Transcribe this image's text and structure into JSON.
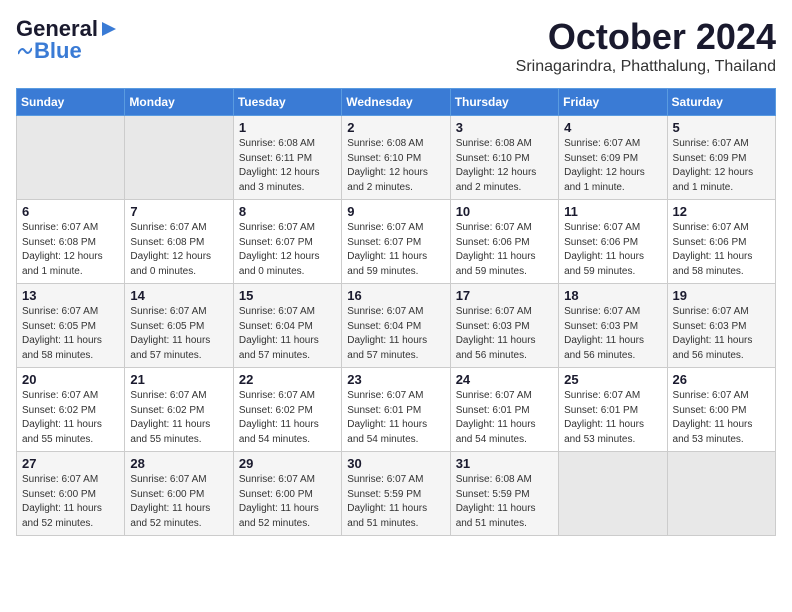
{
  "header": {
    "logo": {
      "general": "General",
      "blue": "Blue"
    },
    "title": "October 2024",
    "subtitle": "Srinagarindra, Phatthalung, Thailand"
  },
  "calendar": {
    "weekdays": [
      "Sunday",
      "Monday",
      "Tuesday",
      "Wednesday",
      "Thursday",
      "Friday",
      "Saturday"
    ],
    "weeks": [
      [
        {
          "day": "",
          "info": ""
        },
        {
          "day": "",
          "info": ""
        },
        {
          "day": "1",
          "info": "Sunrise: 6:08 AM\nSunset: 6:11 PM\nDaylight: 12 hours\nand 3 minutes."
        },
        {
          "day": "2",
          "info": "Sunrise: 6:08 AM\nSunset: 6:10 PM\nDaylight: 12 hours\nand 2 minutes."
        },
        {
          "day": "3",
          "info": "Sunrise: 6:08 AM\nSunset: 6:10 PM\nDaylight: 12 hours\nand 2 minutes."
        },
        {
          "day": "4",
          "info": "Sunrise: 6:07 AM\nSunset: 6:09 PM\nDaylight: 12 hours\nand 1 minute."
        },
        {
          "day": "5",
          "info": "Sunrise: 6:07 AM\nSunset: 6:09 PM\nDaylight: 12 hours\nand 1 minute."
        }
      ],
      [
        {
          "day": "6",
          "info": "Sunrise: 6:07 AM\nSunset: 6:08 PM\nDaylight: 12 hours\nand 1 minute."
        },
        {
          "day": "7",
          "info": "Sunrise: 6:07 AM\nSunset: 6:08 PM\nDaylight: 12 hours\nand 0 minutes."
        },
        {
          "day": "8",
          "info": "Sunrise: 6:07 AM\nSunset: 6:07 PM\nDaylight: 12 hours\nand 0 minutes."
        },
        {
          "day": "9",
          "info": "Sunrise: 6:07 AM\nSunset: 6:07 PM\nDaylight: 11 hours\nand 59 minutes."
        },
        {
          "day": "10",
          "info": "Sunrise: 6:07 AM\nSunset: 6:06 PM\nDaylight: 11 hours\nand 59 minutes."
        },
        {
          "day": "11",
          "info": "Sunrise: 6:07 AM\nSunset: 6:06 PM\nDaylight: 11 hours\nand 59 minutes."
        },
        {
          "day": "12",
          "info": "Sunrise: 6:07 AM\nSunset: 6:06 PM\nDaylight: 11 hours\nand 58 minutes."
        }
      ],
      [
        {
          "day": "13",
          "info": "Sunrise: 6:07 AM\nSunset: 6:05 PM\nDaylight: 11 hours\nand 58 minutes."
        },
        {
          "day": "14",
          "info": "Sunrise: 6:07 AM\nSunset: 6:05 PM\nDaylight: 11 hours\nand 57 minutes."
        },
        {
          "day": "15",
          "info": "Sunrise: 6:07 AM\nSunset: 6:04 PM\nDaylight: 11 hours\nand 57 minutes."
        },
        {
          "day": "16",
          "info": "Sunrise: 6:07 AM\nSunset: 6:04 PM\nDaylight: 11 hours\nand 57 minutes."
        },
        {
          "day": "17",
          "info": "Sunrise: 6:07 AM\nSunset: 6:03 PM\nDaylight: 11 hours\nand 56 minutes."
        },
        {
          "day": "18",
          "info": "Sunrise: 6:07 AM\nSunset: 6:03 PM\nDaylight: 11 hours\nand 56 minutes."
        },
        {
          "day": "19",
          "info": "Sunrise: 6:07 AM\nSunset: 6:03 PM\nDaylight: 11 hours\nand 56 minutes."
        }
      ],
      [
        {
          "day": "20",
          "info": "Sunrise: 6:07 AM\nSunset: 6:02 PM\nDaylight: 11 hours\nand 55 minutes."
        },
        {
          "day": "21",
          "info": "Sunrise: 6:07 AM\nSunset: 6:02 PM\nDaylight: 11 hours\nand 55 minutes."
        },
        {
          "day": "22",
          "info": "Sunrise: 6:07 AM\nSunset: 6:02 PM\nDaylight: 11 hours\nand 54 minutes."
        },
        {
          "day": "23",
          "info": "Sunrise: 6:07 AM\nSunset: 6:01 PM\nDaylight: 11 hours\nand 54 minutes."
        },
        {
          "day": "24",
          "info": "Sunrise: 6:07 AM\nSunset: 6:01 PM\nDaylight: 11 hours\nand 54 minutes."
        },
        {
          "day": "25",
          "info": "Sunrise: 6:07 AM\nSunset: 6:01 PM\nDaylight: 11 hours\nand 53 minutes."
        },
        {
          "day": "26",
          "info": "Sunrise: 6:07 AM\nSunset: 6:00 PM\nDaylight: 11 hours\nand 53 minutes."
        }
      ],
      [
        {
          "day": "27",
          "info": "Sunrise: 6:07 AM\nSunset: 6:00 PM\nDaylight: 11 hours\nand 52 minutes."
        },
        {
          "day": "28",
          "info": "Sunrise: 6:07 AM\nSunset: 6:00 PM\nDaylight: 11 hours\nand 52 minutes."
        },
        {
          "day": "29",
          "info": "Sunrise: 6:07 AM\nSunset: 6:00 PM\nDaylight: 11 hours\nand 52 minutes."
        },
        {
          "day": "30",
          "info": "Sunrise: 6:07 AM\nSunset: 5:59 PM\nDaylight: 11 hours\nand 51 minutes."
        },
        {
          "day": "31",
          "info": "Sunrise: 6:08 AM\nSunset: 5:59 PM\nDaylight: 11 hours\nand 51 minutes."
        },
        {
          "day": "",
          "info": ""
        },
        {
          "day": "",
          "info": ""
        }
      ]
    ]
  }
}
